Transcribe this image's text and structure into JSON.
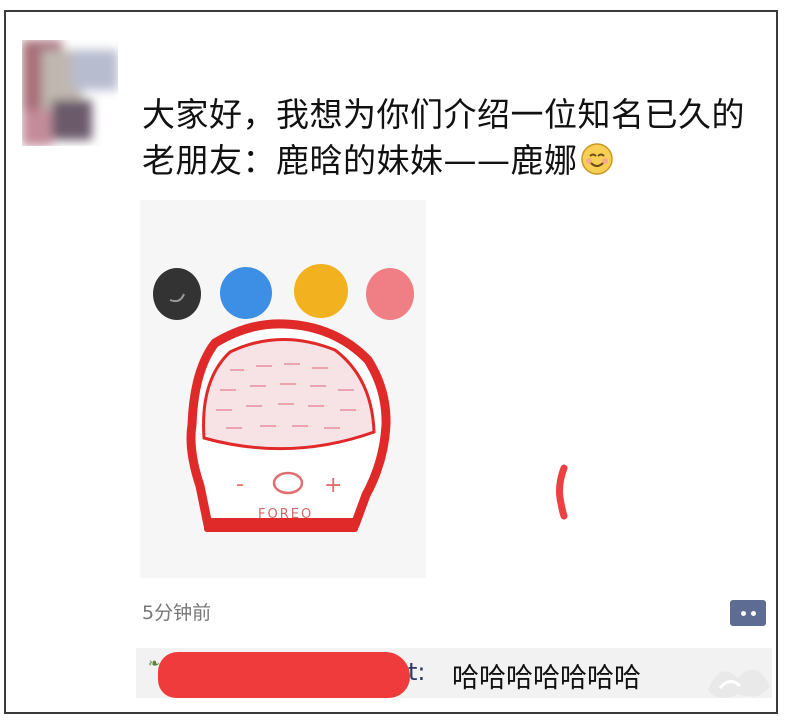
{
  "post": {
    "line1": "大家好，我想为你们介绍一位知名已久的",
    "line2": "老朋友：鹿晗的妹妹——鹿娜",
    "emoji": "smile-emoji"
  },
  "photo": {
    "brand_text": "FOREO",
    "minus": "-",
    "plus": "+"
  },
  "meta": {
    "timestamp": "5分钟前"
  },
  "comment": {
    "name_tail": "t:",
    "text": "哈哈哈哈哈哈哈"
  },
  "colors": {
    "accent_blue": "#5d6c92",
    "name_blue": "#2d3a62",
    "redaction_red": "#ef3b3b",
    "device_red": "#e02a2a"
  }
}
